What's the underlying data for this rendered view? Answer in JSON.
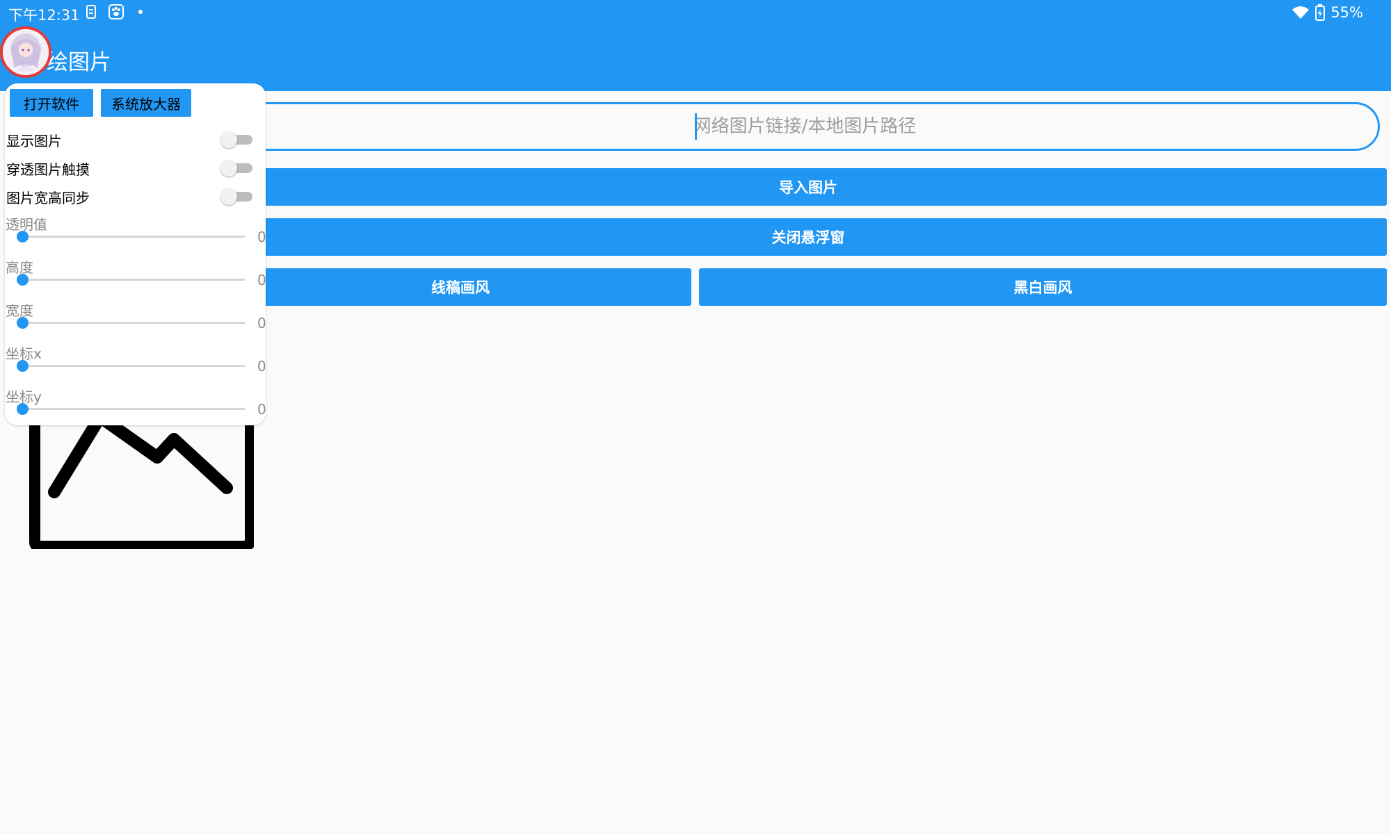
{
  "status_bar": {
    "time": "下午12:31",
    "battery": "55%",
    "icons": [
      "sim-icon",
      "paw-icon",
      "wifi-icon",
      "battery-icon"
    ]
  },
  "app_bar": {
    "title": "绘图片",
    "color": "#2196f3"
  },
  "main": {
    "url_input": {
      "placeholder": "网络图片链接/本地图片路径",
      "value": ""
    },
    "import_label": "导入图片",
    "close_label": "关闭悬浮窗",
    "line_style_label": "线稿画风",
    "bw_style_label": "黑白画风",
    "placeholder_icon": "image-icon"
  },
  "float_panel": {
    "open_app_label": "打开软件",
    "magnifier_label": "系统放大器",
    "switches": [
      {
        "label": "显示图片",
        "on": false
      },
      {
        "label": "穿透图片触摸",
        "on": false
      },
      {
        "label": "图片宽高同步",
        "on": false
      }
    ],
    "sliders": [
      {
        "label": "透明值",
        "value": "0"
      },
      {
        "label": "高度",
        "value": "0"
      },
      {
        "label": "宽度",
        "value": "0"
      },
      {
        "label": "坐标x",
        "value": "0"
      },
      {
        "label": "坐标y",
        "value": "0"
      }
    ]
  }
}
